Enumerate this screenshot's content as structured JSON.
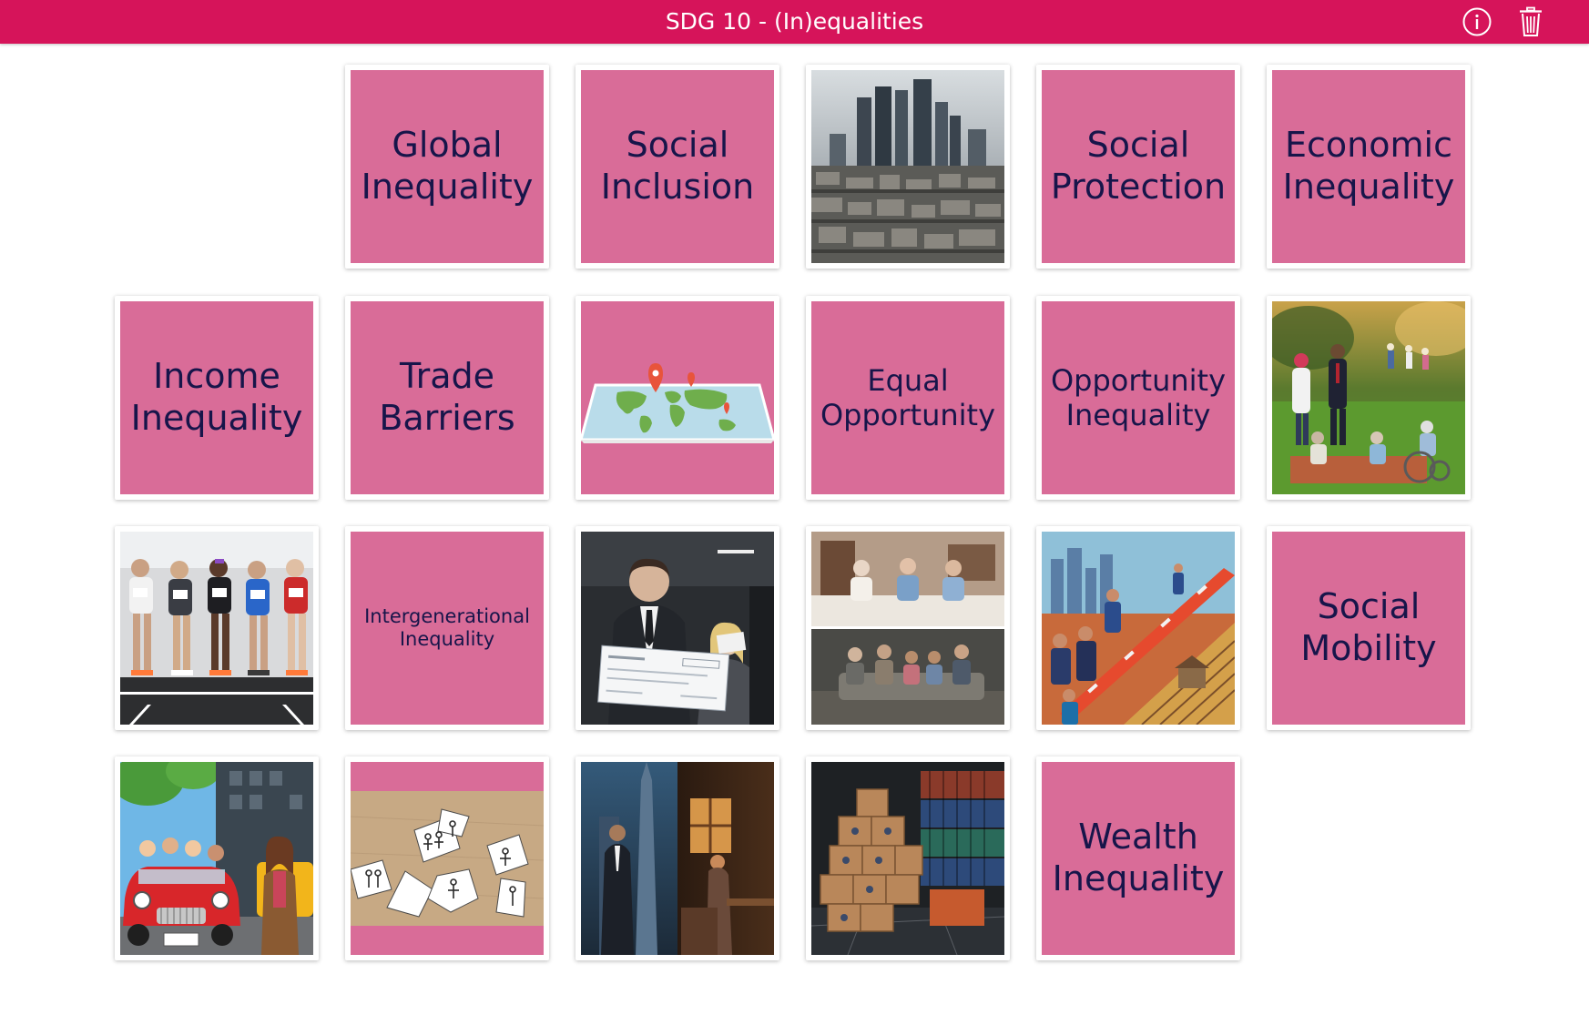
{
  "app": {
    "title": "SDG 10 - (In)equalities",
    "accent_color": "#d6145a",
    "card_color": "#d96c98",
    "text_color": "#17154a",
    "icons": {
      "info": "info-icon",
      "trash": "trash-icon"
    }
  },
  "cards": {
    "global_inequality": "Global Inequality",
    "social_inclusion": "Social Inclusion",
    "social_protection": "Social Protection",
    "economic_inequality": "Economic Inequality",
    "income_inequality": "Income Inequality",
    "trade_barriers": "Trade Barriers",
    "equal_opportunity": "Equal Opportunity",
    "opportunity_inequality": "Opportunity Inequality",
    "intergenerational_inequality": "Intergenerational Inequality",
    "social_mobility": "Social Mobility",
    "wealth_inequality": "Wealth Inequality"
  }
}
